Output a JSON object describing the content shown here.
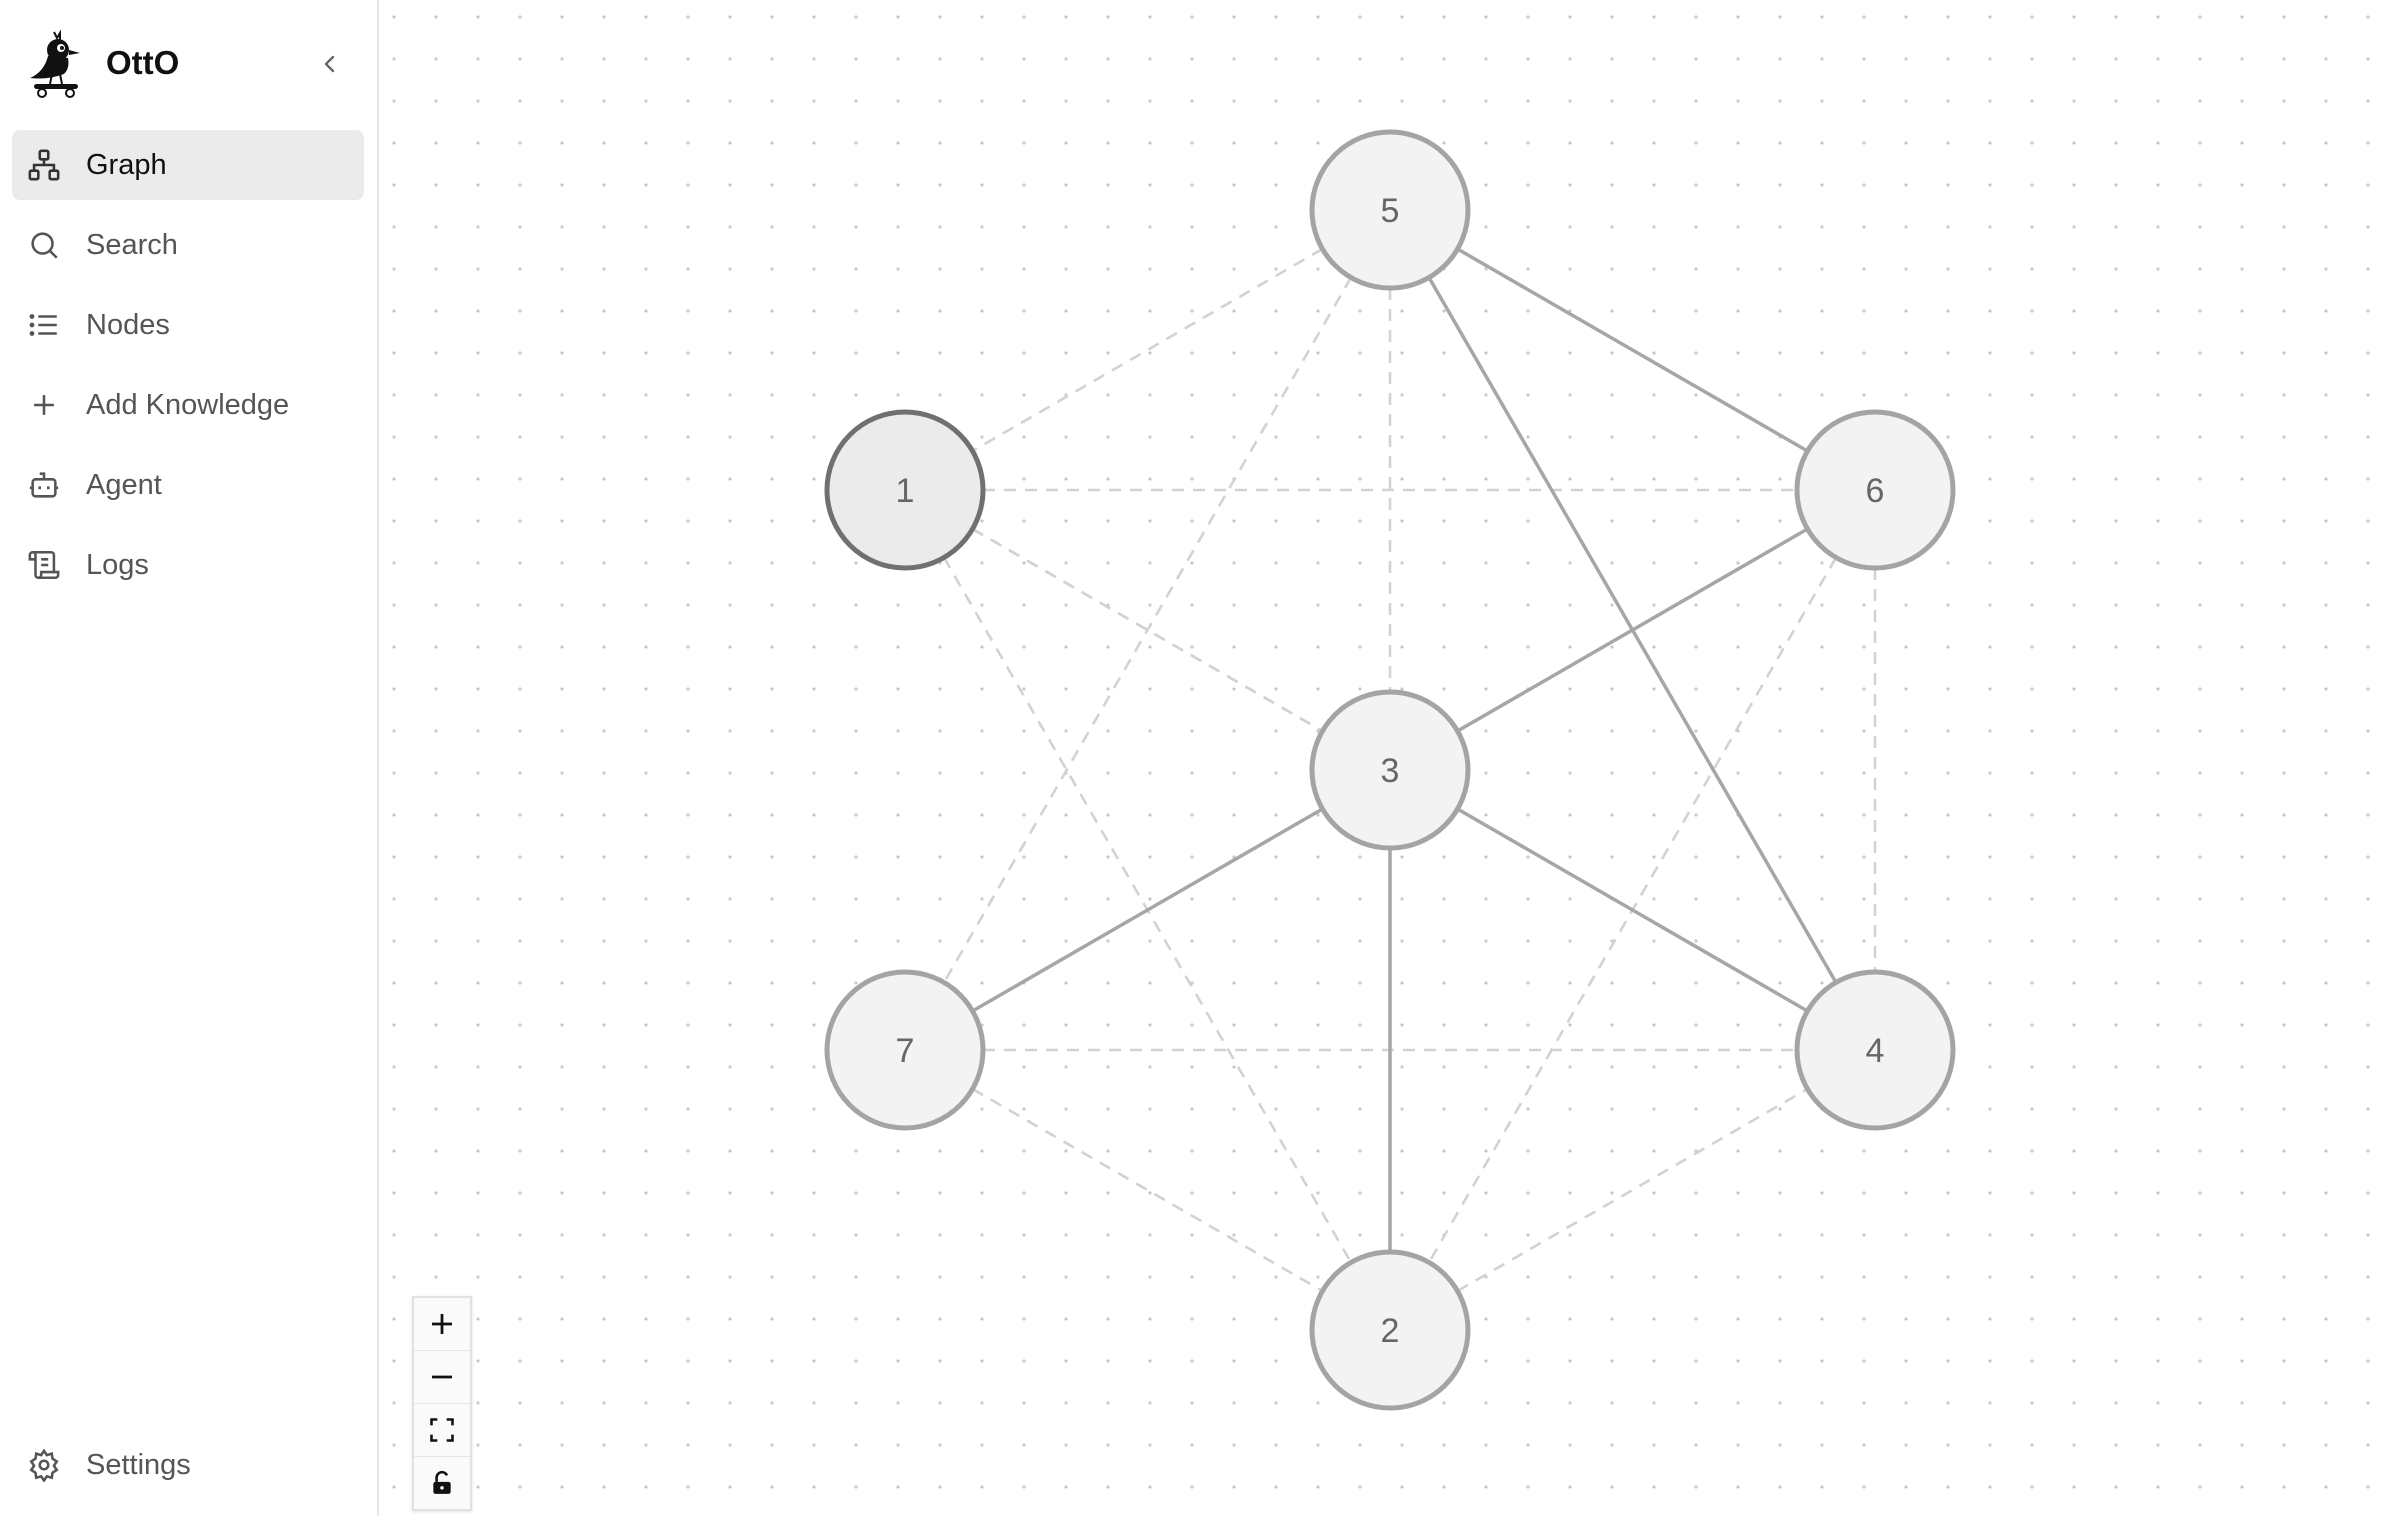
{
  "app": {
    "name": "OttO"
  },
  "sidebar": {
    "items": [
      {
        "id": "graph",
        "label": "Graph",
        "icon": "graph-icon",
        "active": true
      },
      {
        "id": "search",
        "label": "Search",
        "icon": "search-icon",
        "active": false
      },
      {
        "id": "nodes",
        "label": "Nodes",
        "icon": "list-icon",
        "active": false
      },
      {
        "id": "add-knowledge",
        "label": "Add Knowledge",
        "icon": "plus-icon",
        "active": false
      },
      {
        "id": "agent",
        "label": "Agent",
        "icon": "bot-icon",
        "active": false
      },
      {
        "id": "logs",
        "label": "Logs",
        "icon": "scroll-icon",
        "active": false
      }
    ],
    "settings_label": "Settings"
  },
  "graph": {
    "nodes": [
      {
        "id": "1",
        "label": "1",
        "selected": true
      },
      {
        "id": "2",
        "label": "2"
      },
      {
        "id": "3",
        "label": "3"
      },
      {
        "id": "4",
        "label": "4"
      },
      {
        "id": "5",
        "label": "5"
      },
      {
        "id": "6",
        "label": "6"
      },
      {
        "id": "7",
        "label": "7"
      }
    ]
  },
  "zoom_controls": [
    "zoom-in",
    "zoom-out",
    "fit-view",
    "lock"
  ]
}
